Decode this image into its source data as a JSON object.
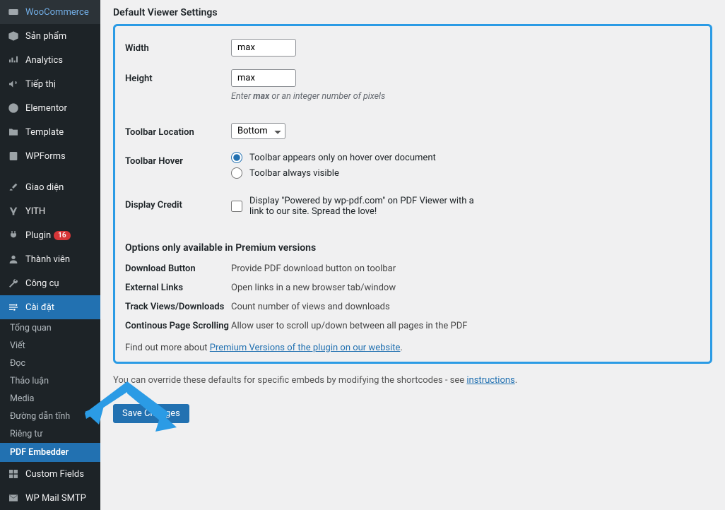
{
  "sidebar": {
    "items": [
      {
        "icon": "w",
        "label": "WooCommerce"
      },
      {
        "icon": "box",
        "label": "Sản phẩm"
      },
      {
        "icon": "chart",
        "label": "Analytics"
      },
      {
        "icon": "megaphone",
        "label": "Tiếp thị"
      },
      {
        "icon": "e",
        "label": "Elementor"
      },
      {
        "icon": "folder",
        "label": "Template"
      },
      {
        "icon": "form",
        "label": "WPForms"
      },
      {
        "icon": "brush",
        "label": "Giao diện"
      },
      {
        "icon": "y",
        "label": "YITH"
      },
      {
        "icon": "plug",
        "label": "Plugin",
        "badge": "16"
      },
      {
        "icon": "user",
        "label": "Thành viên"
      },
      {
        "icon": "wrench",
        "label": "Công cụ"
      },
      {
        "icon": "sliders",
        "label": "Cài đặt",
        "active": true
      }
    ],
    "sub": [
      "Tổng quan",
      "Viết",
      "Đọc",
      "Thảo luận",
      "Media",
      "Đường dẫn tĩnh",
      "Riêng tư"
    ],
    "sub_highlight": "PDF Embedder",
    "tail": [
      {
        "icon": "cf",
        "label": "Custom Fields"
      },
      {
        "icon": "mail",
        "label": "WP Mail SMTP"
      }
    ]
  },
  "form": {
    "section_title": "Default Viewer Settings",
    "width_label": "Width",
    "width_value": "max",
    "height_label": "Height",
    "height_value": "max",
    "height_hint_a": "Enter ",
    "height_hint_b": "max",
    "height_hint_c": " or an integer number of pixels",
    "toolbar_loc_label": "Toolbar Location",
    "toolbar_loc_value": "Bottom",
    "toolbar_hover_label": "Toolbar Hover",
    "hover_opt1": "Toolbar appears only on hover over document",
    "hover_opt2": "Toolbar always visible",
    "credit_label": "Display Credit",
    "credit_text": "Display \"Powered by wp-pdf.com\" on PDF Viewer with a link to our site. Spread the love!",
    "premium_title": "Options only available in Premium versions",
    "prem": [
      {
        "label": "Download Button",
        "desc": "Provide PDF download button on toolbar"
      },
      {
        "label": "External Links",
        "desc": "Open links in a new browser tab/window"
      },
      {
        "label": "Track Views/Downloads",
        "desc": "Count number of views and downloads"
      },
      {
        "label": "Continous Page Scrolling",
        "desc": "Allow user to scroll up/down between all pages in the PDF"
      }
    ],
    "findout_a": "Find out more about ",
    "findout_link": "Premium Versions of the plugin on our website",
    "override_a": "You can override these defaults for specific embeds by modifying the shortcodes - see ",
    "override_link": "instructions",
    "save_btn": "Save Changes"
  }
}
